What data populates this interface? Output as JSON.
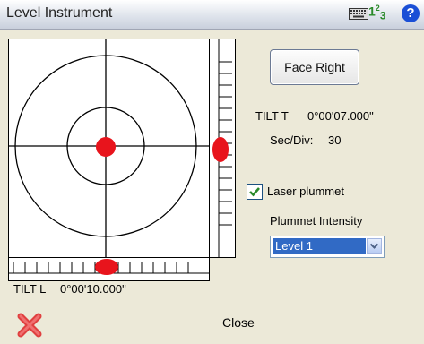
{
  "window": {
    "title": "Level Instrument"
  },
  "status": {
    "input_mode": "123",
    "input_mode_base": "1",
    "input_mode_super": "2",
    "input_mode_sub": "3"
  },
  "buttons": {
    "face_right": "Face Right",
    "close": "Close"
  },
  "readouts": {
    "tilt_t_label": "TILT T",
    "tilt_t_value": "0°00'07.000\"",
    "sec_div_label": "Sec/Div:",
    "sec_div_value": "30",
    "tilt_l_label": "TILT L",
    "tilt_l_value": "0°00'10.000\""
  },
  "laser": {
    "label": "Laser plummet",
    "checked": true
  },
  "plummet": {
    "label": "Plummet Intensity",
    "selected": "Level 1"
  },
  "icons": [
    "keyboard-icon",
    "help-icon",
    "close-icon"
  ],
  "colors": {
    "bubble": "#e8141c",
    "accent": "#316ac5",
    "check": "#2a8a2a"
  }
}
